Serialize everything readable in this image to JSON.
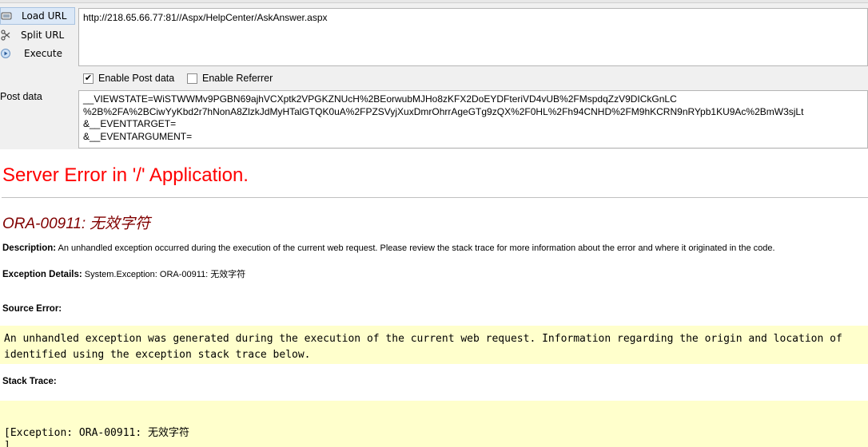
{
  "hackbar": {
    "load_url_label": "Load URL",
    "split_url_label": "Split URL",
    "execute_label": "Execute",
    "url_value": "http://218.65.66.77:81//Aspx/HelpCenter/AskAnswer.aspx",
    "enable_post_label": "Enable Post data",
    "enable_post_checked": true,
    "enable_referrer_label": "Enable Referrer",
    "enable_referrer_checked": false,
    "post_data_label": "Post data",
    "post_lines": [
      "__VIEWSTATE=WiSTWWMv9PGBN69ajhVCXptk2VPGKZNUcH%2BEorwubMJHo8zKFX2DoEYDFteriVD4vUB%2FMspdqZzV9DICkGnLC",
      "%2B%2FA%2BCiwYyKbd2r7hNonA8ZlzkJdMyHTalGTQK0uA%2FPZSVyjXuxDmrOhrrAgeGTg9zQX%2F0HL%2Fh94CNHD%2FM9hKCRN9nRYpb1KU9Ac%2BmW3sjLt",
      "&__EVENTTARGET=",
      "&__EVENTARGUMENT="
    ]
  },
  "error_page": {
    "title": "Server Error in '/' Application.",
    "ora_code": "ORA-00911:",
    "ora_message": " 无效字符",
    "description_label": "Description:",
    "description_text": " An unhandled exception occurred during the execution of the current web request. Please review the stack trace for more information about the error and where it originated in the code.",
    "exception_details_label": "Exception Details:",
    "exception_details_text": " System.Exception: ORA-00911: 无效字符",
    "source_error_label": "Source Error:",
    "source_error_lines": [
      "An unhandled exception was generated during the execution of the current web request. Information regarding the origin and location of",
      "identified using the exception stack trace below."
    ],
    "stack_trace_label": "Stack Trace:",
    "stack_trace_lines": [
      "[Exception: ORA-00911: 无效字符",
      "]"
    ]
  }
}
